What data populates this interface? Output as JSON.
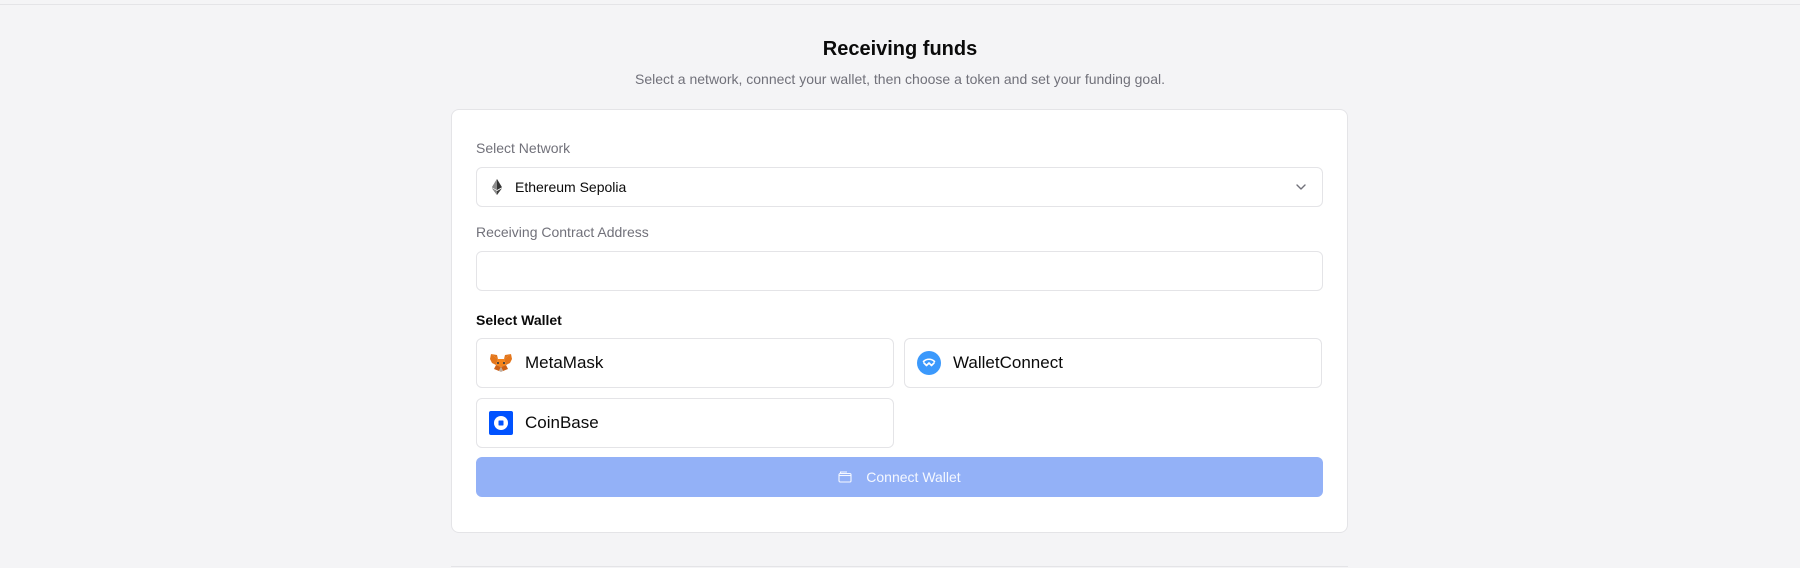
{
  "header": {
    "title": "Receiving funds",
    "subtitle": "Select a network, connect your wallet, then choose a token and set your funding goal."
  },
  "network": {
    "label": "Select Network",
    "selected": "Ethereum Sepolia",
    "icon": "ethereum-icon"
  },
  "contract": {
    "label": "Receiving Contract Address",
    "value": "",
    "placeholder": ""
  },
  "wallets": {
    "label": "Select Wallet",
    "items": [
      {
        "label": "MetaMask",
        "icon": "metamask-fox-icon"
      },
      {
        "label": "WalletConnect",
        "icon": "walletconnect-icon"
      },
      {
        "label": "CoinBase",
        "icon": "coinbase-icon"
      }
    ]
  },
  "connect_button": {
    "label": "Connect Wallet",
    "icon": "wallet-icon",
    "state": "disabled"
  },
  "colors": {
    "page_background": "#f4f4f6",
    "button_disabled": "#93b1f7",
    "walletconnect_blue": "#3b99fc",
    "coinbase_blue": "#0052ff",
    "metamask_orange": "#e2761b"
  }
}
